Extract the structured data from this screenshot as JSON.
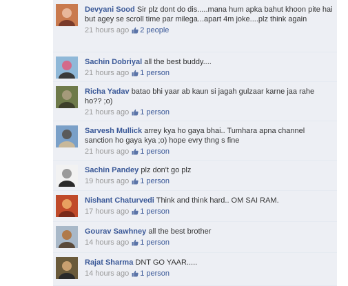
{
  "comments": [
    {
      "name": "Devyani Sood",
      "text": "Sir plz dont do dis.....mana hum apka bahut khoon pite hai but agey se scroll time par milega...apart 4m joke....plz think again",
      "time": "21 hours ago",
      "likes": "2 people",
      "avatar_colors": [
        "#c97a4e",
        "#e8b79a",
        "#7a3b2a"
      ]
    },
    {
      "name": "Sachin Dobriyal",
      "text": "all the best buddy....",
      "time": "21 hours ago",
      "likes": "1 person",
      "avatar_colors": [
        "#8fb8d8",
        "#d46a8a",
        "#3a3a3a"
      ]
    },
    {
      "name": "Richa Yadav",
      "text": "batao bhi yaar ab kaun si jagah gulzaar karne jaa rahe ho?? ;o)",
      "time": "21 hours ago",
      "likes": "1 person",
      "avatar_colors": [
        "#6e7a4a",
        "#a59a7a",
        "#3d3f2a"
      ]
    },
    {
      "name": "Sarvesh Mullick",
      "text": "arrey kya ho gaya bhai.. Tumhara apna channel sanction ho gaya kya ;o) hope evry thng s fine",
      "time": "21 hours ago",
      "likes": "1 person",
      "avatar_colors": [
        "#7aa0c8",
        "#5a5a5a",
        "#c8b89a"
      ]
    },
    {
      "name": "Sachin Pandey",
      "text": "plz don't go plz",
      "time": "19 hours ago",
      "likes": "1 person",
      "avatar_colors": [
        "#f2f2f2",
        "#9a9a9a",
        "#2a2a2a"
      ]
    },
    {
      "name": "Nishant Chaturvedi",
      "text": "Think and think hard.. OM SAI RAM.",
      "time": "17 hours ago",
      "likes": "1 person",
      "avatar_colors": [
        "#c04a2a",
        "#e8a060",
        "#7a2a1a"
      ]
    },
    {
      "name": "Gourav Sawhney",
      "text": "all the best brother",
      "time": "14 hours ago",
      "likes": "1 person",
      "avatar_colors": [
        "#a8b8c8",
        "#b07a4a",
        "#5a4a3a"
      ]
    },
    {
      "name": "Rajat Sharma",
      "text": "DNT GO YAAR.....",
      "time": "14 hours ago",
      "likes": "1 person",
      "avatar_colors": [
        "#6a5a3a",
        "#c8a070",
        "#2a2a2a"
      ]
    }
  ],
  "colors": {
    "link": "#3b5998",
    "comment_bg": "#edeff4",
    "meta": "#999999",
    "text": "#333333"
  }
}
